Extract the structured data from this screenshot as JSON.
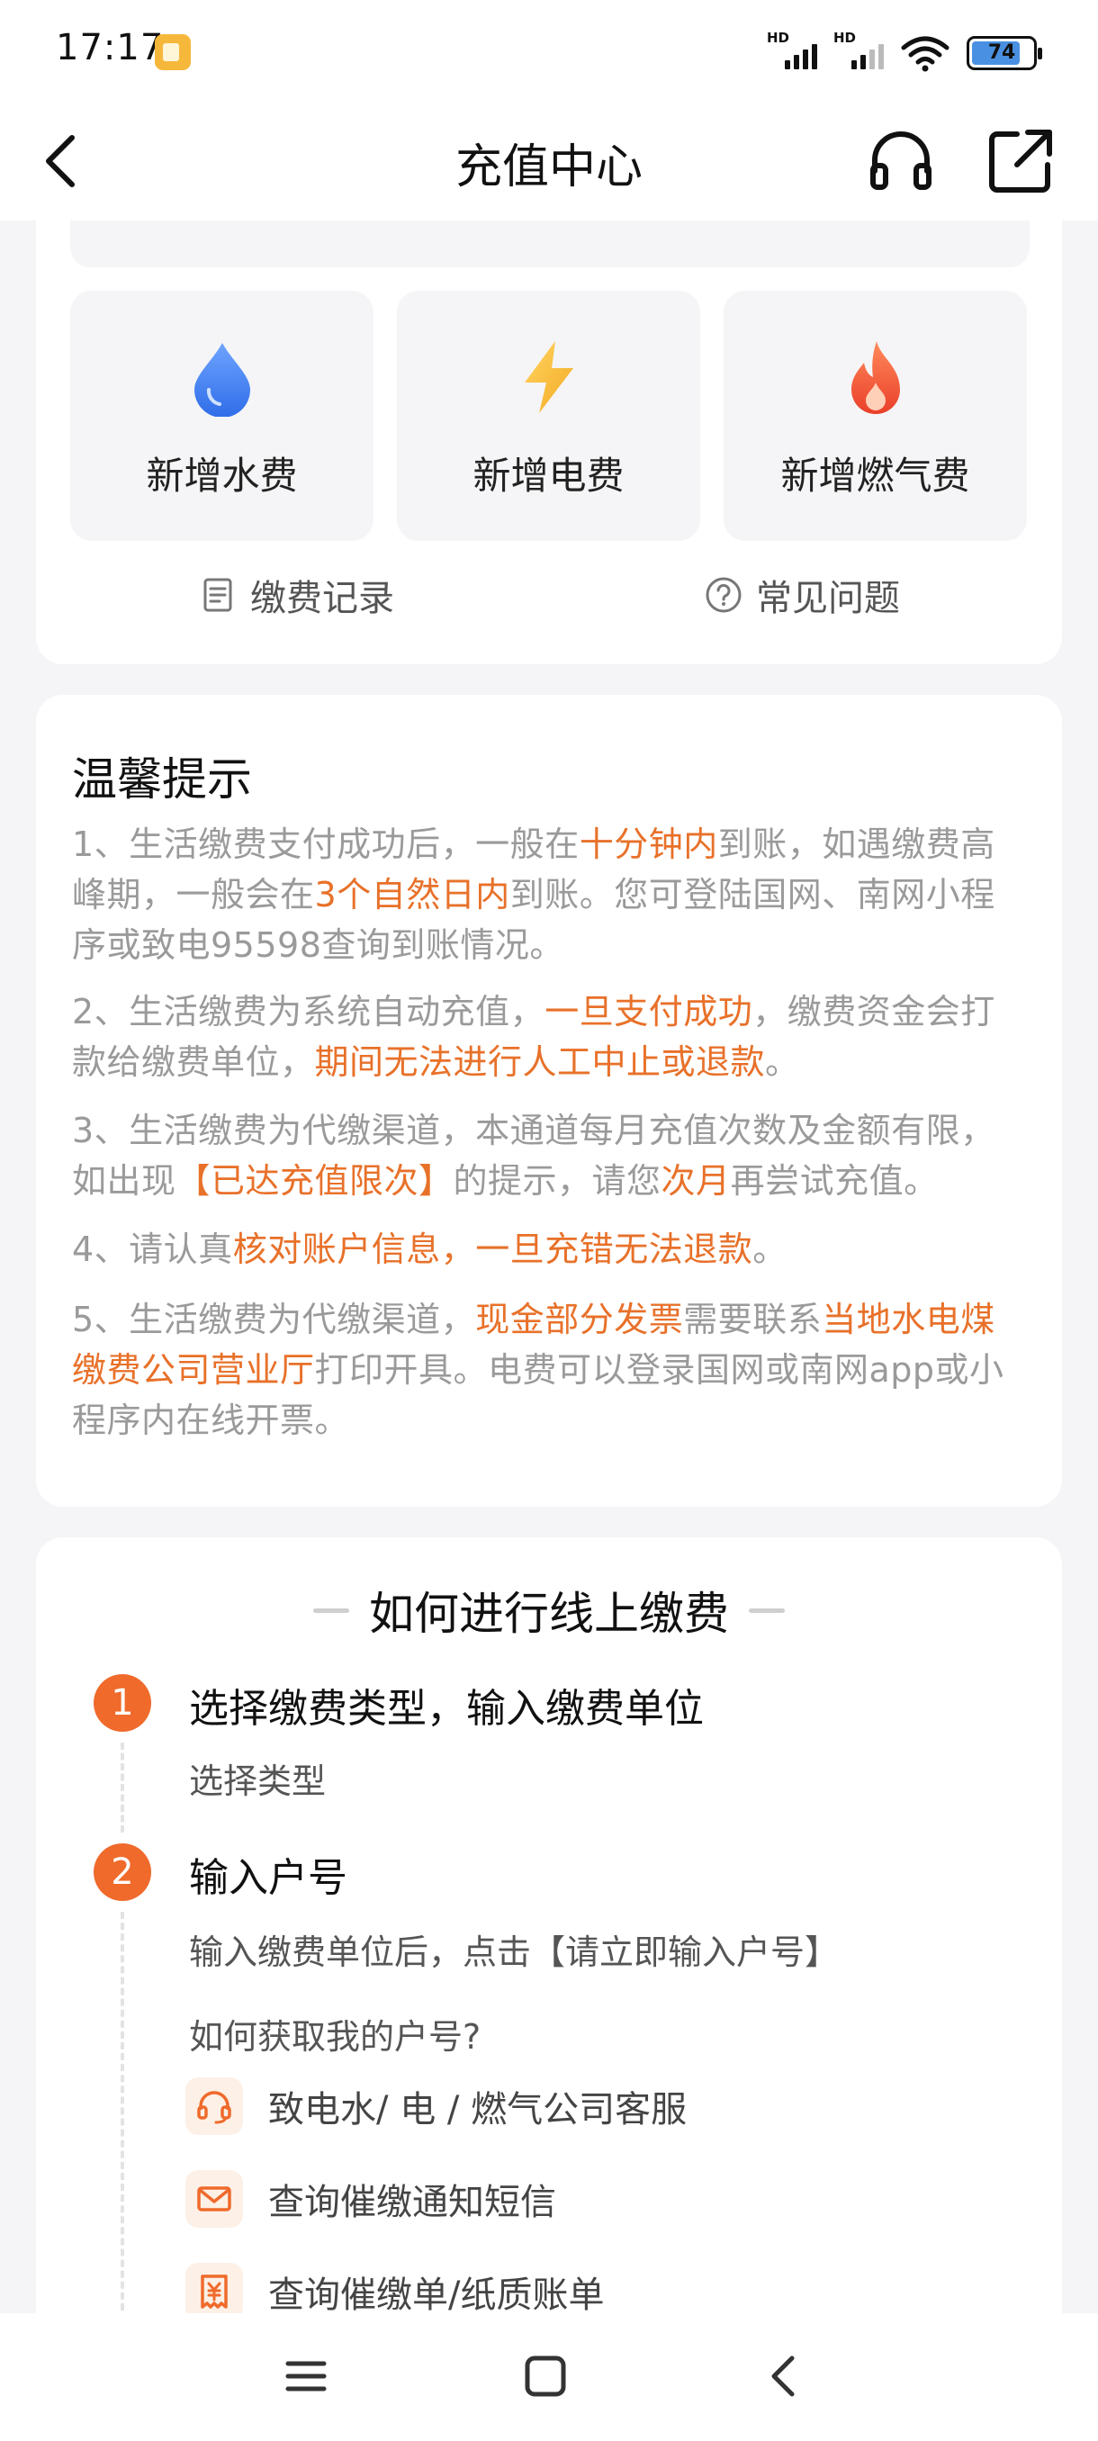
{
  "status_bar": {
    "time": "17:17",
    "sim1_label": "HD",
    "sim2_label": "HD",
    "battery_level": "74"
  },
  "nav": {
    "title": "充值中心",
    "back_icon": "chevron-left-icon",
    "service_icon": "headset-icon",
    "share_icon": "share-external-icon"
  },
  "services": {
    "items": [
      {
        "label": "新增水费",
        "icon": "water-drop-icon",
        "color": "#3d7cf5"
      },
      {
        "label": "新增电费",
        "icon": "lightning-icon",
        "color": "#f6b93b"
      },
      {
        "label": "新增燃气费",
        "icon": "flame-icon",
        "color": "#f05a3a"
      }
    ],
    "records_label": "缴费记录",
    "faq_label": "常见问题"
  },
  "tips": {
    "title": "温馨提示",
    "t1": {
      "a": "1、生活缴费支付成功后，一般在",
      "b": "十分钟内",
      "c": "到账，如遇缴费高峰期，一般会在",
      "d": "3个自然日内",
      "e": "到账。您可登陆国网、南网小程序或致电95598查询到账情况。"
    },
    "t2": {
      "a": "2、生活缴费为系统自动充值，",
      "b": "一旦支付成功",
      "c": "，缴费资金会打款给缴费单位，",
      "d": "期间无法进行人工中止或退款",
      "e": "。"
    },
    "t3": {
      "a": "3、生活缴费为代缴渠道，本通道每月充值次数及金额有限，如出现",
      "b": "【已达充值限次】",
      "c": "的提示，请您",
      "d": "次月",
      "e": "再尝试充值。"
    },
    "t4": {
      "a": "4、请认真",
      "b": "核对账户信息，一旦充错无法退款",
      "c": "。"
    },
    "t5": {
      "a": "5、生活缴费为代缴渠道，",
      "b": "现金部分发票",
      "c": "需要联系",
      "d": "当地水电煤缴费公司营业厅",
      "e": "打印开具。电费可以登录国网或南网app或小程序内在线开票。"
    },
    "highlight_color": "#e8712a"
  },
  "howto": {
    "title": "如何进行线上缴费",
    "steps": [
      {
        "num": "1",
        "title": "选择缴费类型，输入缴费单位",
        "sub": "选择类型"
      },
      {
        "num": "2",
        "title": "输入户号",
        "sub": "输入缴费单位后，点击【请立即输入户号】",
        "question": "如何获取我的户号?"
      }
    ],
    "methods": [
      {
        "label": "致电水/ 电 / 燃气公司客服",
        "icon": "headset-icon"
      },
      {
        "label": "查询催缴通知短信",
        "icon": "mail-icon"
      },
      {
        "label": "查询催缴单/纸质账单",
        "icon": "yuan-receipt-icon"
      }
    ],
    "accent_color": "#ef6a2b"
  },
  "system_nav": {
    "menu_icon": "menu-icon",
    "home_icon": "home-square-icon",
    "back_icon": "back-triangle-icon"
  }
}
